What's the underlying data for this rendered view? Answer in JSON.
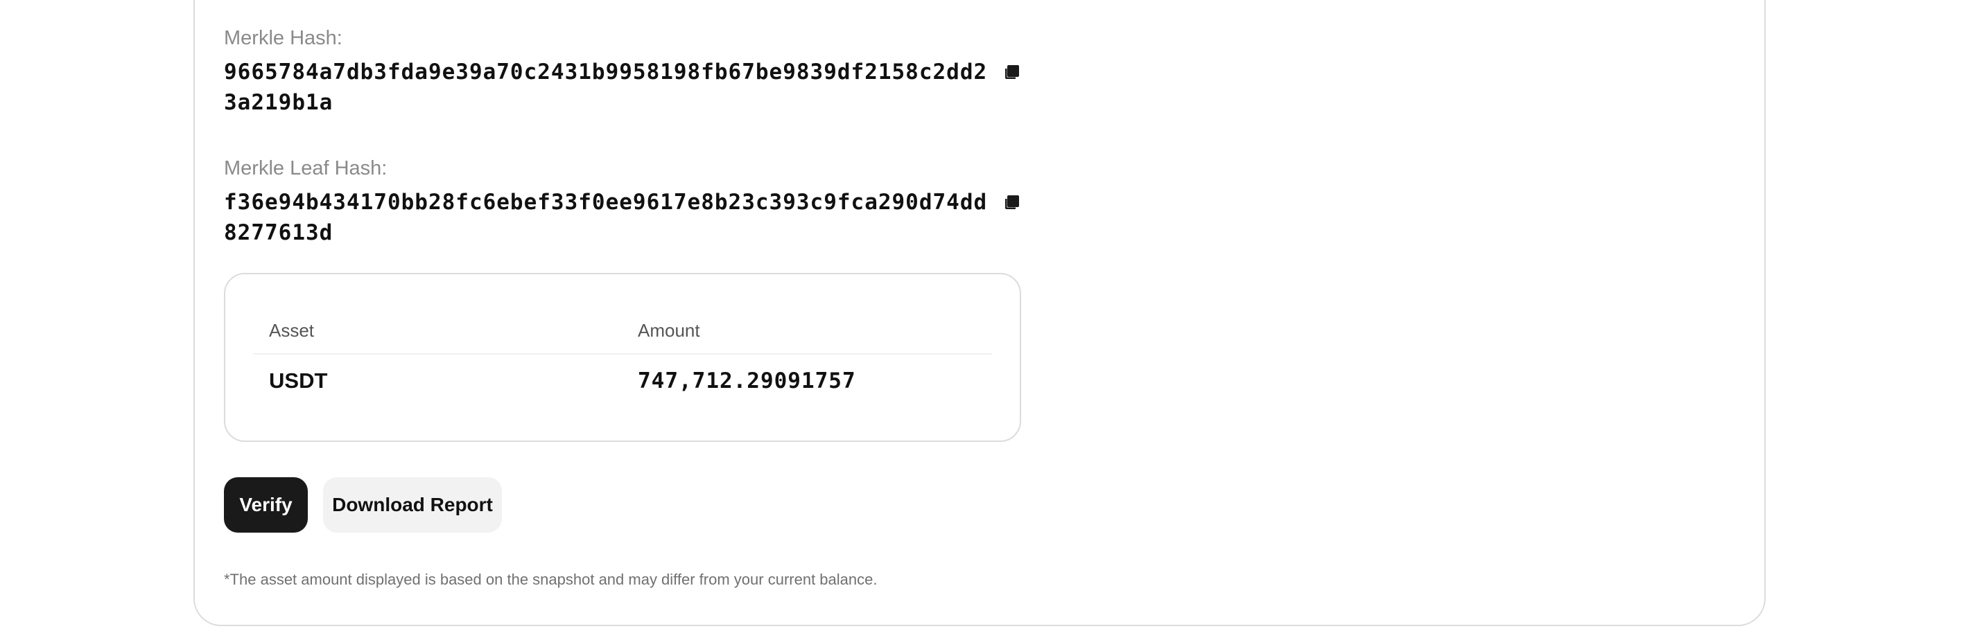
{
  "merkle_hash": {
    "label": "Merkle Hash:",
    "value": "9665784a7db3fda9e39a70c2431b9958198fb67be9839df2158c2dd23a219b1a",
    "copy_icon": "copy-icon"
  },
  "merkle_leaf_hash": {
    "label": "Merkle Leaf Hash:",
    "value": "f36e94b434170bb28fc6ebef33f0ee9617e8b23c393c9fca290d74dd8277613d",
    "copy_icon": "copy-icon"
  },
  "assets_table": {
    "headers": [
      "Asset",
      "Amount"
    ],
    "rows": [
      {
        "asset": "USDT",
        "amount": "747,712.29091757"
      }
    ]
  },
  "actions": {
    "verify_label": "Verify",
    "download_label": "Download Report"
  },
  "footnote": "*The asset amount displayed is based on the snapshot and may differ from your current balance.",
  "colors": {
    "primary_button": "#1a1a1a",
    "secondary_button": "#f2f2f2",
    "border": "#dcdcdc",
    "muted_text": "#8a8a8a"
  }
}
